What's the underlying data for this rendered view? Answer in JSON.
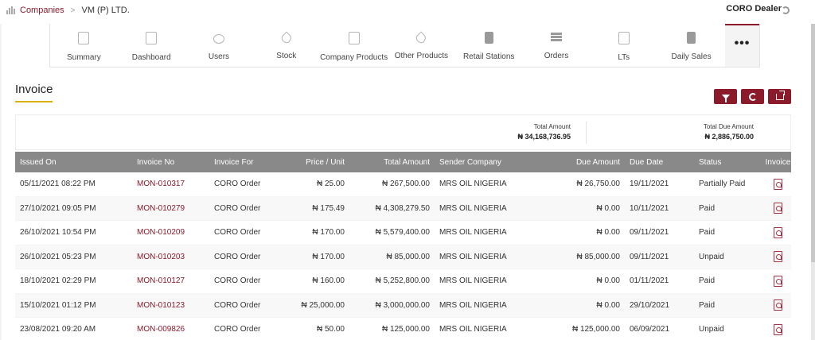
{
  "breadcrumb": {
    "companies": "Companies",
    "separator": ">",
    "current": "VM (P) LTD."
  },
  "header": {
    "user_role": "CORO Dealer"
  },
  "tabs": [
    {
      "label": "Summary",
      "icon": "clipboard-icon"
    },
    {
      "label": "Dashboard",
      "icon": "dashboard-icon"
    },
    {
      "label": "Users",
      "icon": "users-icon"
    },
    {
      "label": "Stock",
      "icon": "drop-icon"
    },
    {
      "label": "Company Products",
      "icon": "fuel-can-icon"
    },
    {
      "label": "Other Products",
      "icon": "drop-icon"
    },
    {
      "label": "Retail Stations",
      "icon": "fuel-pump-icon"
    },
    {
      "label": "Orders",
      "icon": "list-icon"
    },
    {
      "label": "LTs",
      "icon": "document-icon"
    },
    {
      "label": "Daily Sales",
      "icon": "fuel-pump-icon"
    }
  ],
  "more_tab": "•••",
  "page": {
    "title": "Invoice"
  },
  "totals": {
    "total_amount_label": "Total Amount",
    "total_amount_value": "₦ 34,168,736.95",
    "total_due_label": "Total Due Amount",
    "total_due_value": "₦ 2,886,750.00"
  },
  "table": {
    "columns": [
      "Issued On",
      "Invoice No",
      "Invoice For",
      "Price / Unit",
      "Total Amount",
      "Sender Company",
      "Due Amount",
      "Due Date",
      "Status",
      "Invoice"
    ],
    "rows": [
      [
        "05/11/2021 08:22 PM",
        "MON-010317",
        "CORO Order",
        "₦ 25.00",
        "₦ 267,500.00",
        "MRS OIL NIGERIA",
        "₦ 26,750.00",
        "19/11/2021",
        "Partially Paid"
      ],
      [
        "27/10/2021 09:05 PM",
        "MON-010279",
        "CORO Order",
        "₦ 175.49",
        "₦ 4,308,279.50",
        "MRS OIL NIGERIA",
        "₦ 0.00",
        "10/11/2021",
        "Paid"
      ],
      [
        "26/10/2021 10:54 PM",
        "MON-010209",
        "CORO Order",
        "₦ 170.00",
        "₦ 5,579,400.00",
        "MRS OIL NIGERIA",
        "₦ 0.00",
        "09/11/2021",
        "Paid"
      ],
      [
        "26/10/2021 05:23 PM",
        "MON-010203",
        "CORO Order",
        "₦ 170.00",
        "₦ 85,000.00",
        "MRS OIL NIGERIA",
        "₦ 85,000.00",
        "09/11/2021",
        "Unpaid"
      ],
      [
        "18/10/2021 02:29 PM",
        "MON-010127",
        "CORO Order",
        "₦ 160.00",
        "₦ 5,252,800.00",
        "MRS OIL NIGERIA",
        "₦ 0.00",
        "01/11/2021",
        "Paid"
      ],
      [
        "15/10/2021 01:12 PM",
        "MON-010123",
        "CORO Order",
        "₦ 25,000.00",
        "₦ 3,000,000.00",
        "MRS OIL NIGERIA",
        "₦ 0.00",
        "29/10/2021",
        "Paid"
      ],
      [
        "23/08/2021 09:20 AM",
        "MON-009826",
        "CORO Order",
        "₦ 50.00",
        "₦ 125,000.00",
        "MRS OIL NIGERIA",
        "₦ 125,000.00",
        "06/09/2021",
        "Unpaid"
      ]
    ]
  },
  "colors": {
    "brand": "#8b1a2b",
    "header_bg": "#898989",
    "accent_underline": "#e0b000"
  }
}
